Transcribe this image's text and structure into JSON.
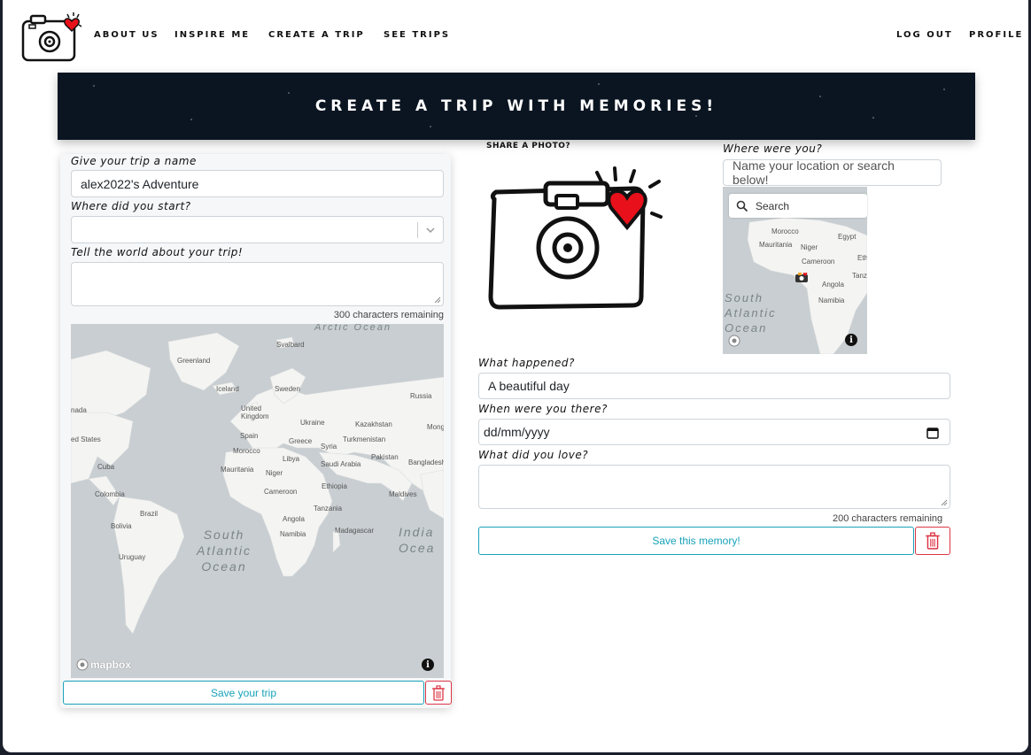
{
  "nav": {
    "items": [
      "About Us",
      "Inspire Me",
      "Create a Trip",
      "See Trips"
    ],
    "logout": "Log Out",
    "profile": "Profile"
  },
  "banner": {
    "title": "Create a trip with memories!"
  },
  "trip": {
    "name_label": "Give your trip a name",
    "name_value": "alex2022's Adventure",
    "start_label": "Where did you start?",
    "start_value": "",
    "about_label": "Tell the world about your trip!",
    "about_value": "",
    "counter": "300 characters remaining",
    "save_label": "Save your trip",
    "map": {
      "attribution": "mapbox",
      "labels": [
        "Greenland",
        "Svalbard",
        "Iceland",
        "Sweden",
        "Russia",
        "United Kingdom",
        "Ukraine",
        "Kazakhstan",
        "Mong",
        "nada",
        "ed States",
        "Spain",
        "Greece",
        "Turkmenistan",
        "Morocco",
        "Libya",
        "Syria",
        "Pakistan",
        "Cuba",
        "Mauritania",
        "Saudi Arabia",
        "Bangladesh",
        "Niger",
        "Cameroon",
        "Ethiopia",
        "Colombia",
        "Maldives",
        "Brazil",
        "Tanzania",
        "Angola",
        "Bolivia",
        "Namibia",
        "Madagascar",
        "Uruguay"
      ],
      "oceans": [
        "South Atlantic Ocean",
        "India Ocea",
        "Arctic Ocean"
      ]
    }
  },
  "memory": {
    "photo_label": "Share a photo?",
    "where_label": "Where were you?",
    "where_placeholder": "Name your location or search below!",
    "search_placeholder": "Search",
    "small_map": {
      "labels": [
        "Morocco",
        "Egypt",
        "Mauritania",
        "Niger",
        "Cameroon",
        "Angola",
        "Namibia",
        "Eth",
        "Tanz"
      ],
      "ocean": "South Atlantic Ocean"
    },
    "happened_label": "What happened?",
    "happened_value": "A beautiful day",
    "when_label": "When were you there?",
    "date_placeholder": "dd/mm/yyyy",
    "loved_label": "What did you love?",
    "loved_value": "",
    "counter": "200 characters remaining",
    "save_label": "Save this memory!"
  },
  "colors": {
    "accent": "#17a2b8",
    "danger": "#dc3545",
    "banner_bg": "#0b1522",
    "heart": "#e8101a"
  },
  "icons": [
    "camera-heart-icon",
    "chevron-down-icon",
    "search-icon",
    "calendar-icon",
    "trash-icon",
    "info-icon",
    "mapbox-logo-icon"
  ]
}
